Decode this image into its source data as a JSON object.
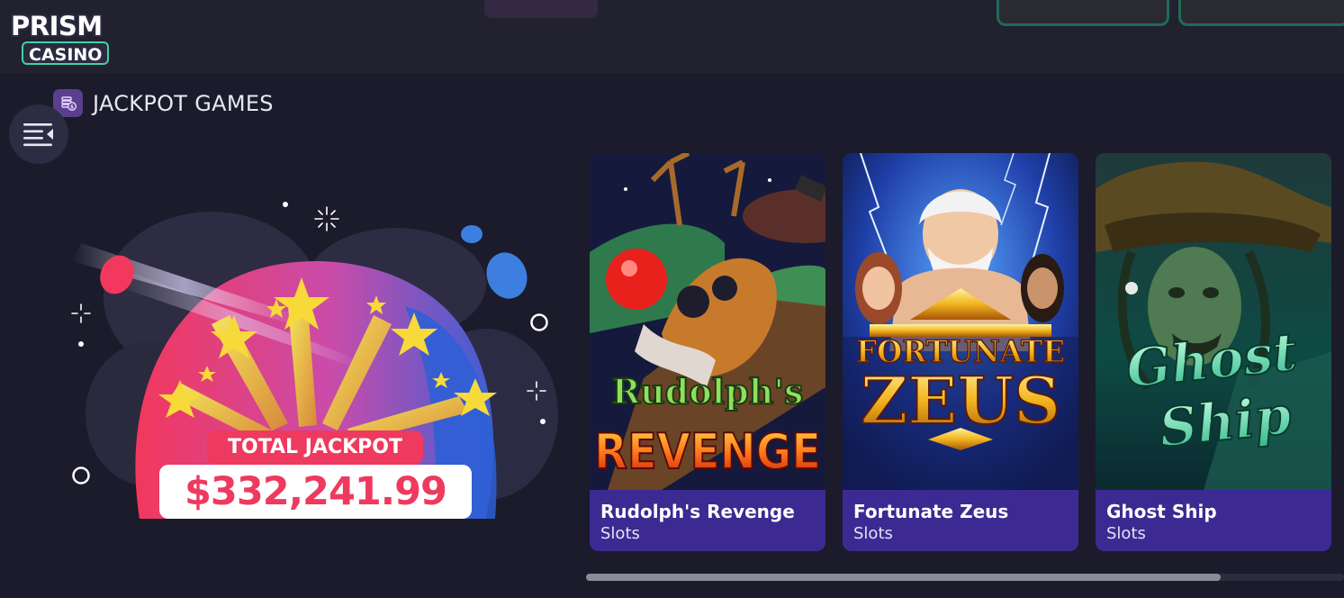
{
  "header": {
    "logo_top": "PRISM",
    "logo_bottom": "CASINO"
  },
  "section": {
    "title": "JACKPOT GAMES",
    "icon": "coin-stack-icon"
  },
  "menu_toggle": {
    "icon": "menu-collapse-icon"
  },
  "jackpot": {
    "label": "TOTAL JACKPOT",
    "amount": "$332,241.99"
  },
  "games": [
    {
      "title": "Rudolph's Revenge",
      "category": "Slots",
      "art_line1": "Rudolph's",
      "art_line2": "REVENGE"
    },
    {
      "title": "Fortunate Zeus",
      "category": "Slots",
      "art_line1": "FORTUNATE",
      "art_line2": "ZEUS"
    },
    {
      "title": "Ghost Ship",
      "category": "Slots",
      "art_line1": "Ghost",
      "art_line2": "Ship"
    }
  ],
  "colors": {
    "background": "#1b1b2c",
    "card_info": "#3c2a92",
    "jackpot_red": "#ee3a5e",
    "accent_green": "#3fd1a8"
  },
  "scroll": {
    "position_fraction": 0.84
  }
}
